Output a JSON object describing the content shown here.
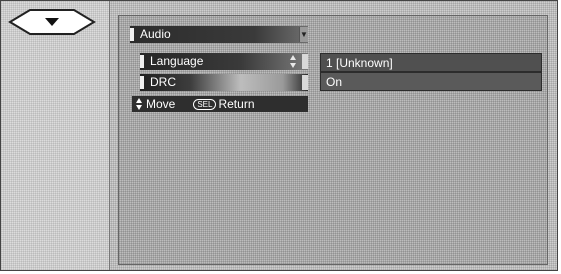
{
  "menu": {
    "title": "Audio",
    "items": [
      {
        "label": "Language",
        "value": "1 [Unknown]"
      },
      {
        "label": "DRC",
        "value": "On"
      }
    ]
  },
  "hints": {
    "move_label": "Move",
    "select_key": "SEL",
    "return_label": "Return"
  },
  "icons": {
    "nav_button": "down-triangle-icon",
    "move": "up-down-arrows-icon",
    "scroll": "up-down-arrows-icon"
  }
}
